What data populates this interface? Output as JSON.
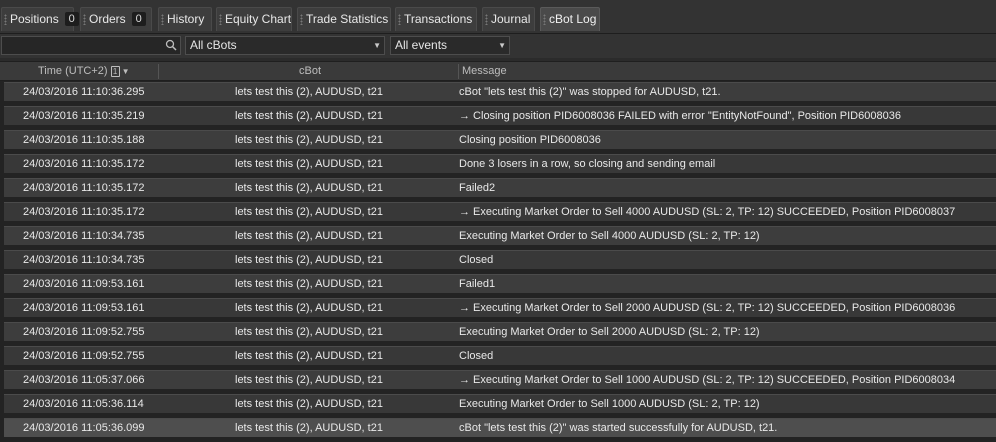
{
  "tabs": [
    {
      "label": "Positions",
      "count": "0"
    },
    {
      "label": "Orders",
      "count": "0"
    },
    {
      "label": "History"
    },
    {
      "label": "Equity Chart"
    },
    {
      "label": "Trade Statistics"
    },
    {
      "label": "Transactions"
    },
    {
      "label": "Journal"
    },
    {
      "label": "cBot Log"
    }
  ],
  "filters": {
    "search_value": "",
    "bot_filter": "All cBots",
    "event_filter": "All events"
  },
  "columns": {
    "time": "Time (UTC+2)",
    "sort_index": "1",
    "cbot": "cBot",
    "message": "Message"
  },
  "rows": [
    {
      "time": "24/03/2016 11:10:36.295",
      "cbot": "lets test this (2), AUDUSD, t21",
      "message": "cBot \"lets test this (2)\" was stopped for AUDUSD, t21."
    },
    {
      "time": "24/03/2016 11:10:35.219",
      "cbot": "lets test this (2), AUDUSD, t21",
      "message": "→ Closing position PID6008036 FAILED with error \"EntityNotFound\", Position PID6008036"
    },
    {
      "time": "24/03/2016 11:10:35.188",
      "cbot": "lets test this (2), AUDUSD, t21",
      "message": "Closing position PID6008036"
    },
    {
      "time": "24/03/2016 11:10:35.172",
      "cbot": "lets test this (2), AUDUSD, t21",
      "message": "Done 3 losers in a row, so closing and sending email"
    },
    {
      "time": "24/03/2016 11:10:35.172",
      "cbot": "lets test this (2), AUDUSD, t21",
      "message": "Failed2"
    },
    {
      "time": "24/03/2016 11:10:35.172",
      "cbot": "lets test this (2), AUDUSD, t21",
      "message": "→ Executing Market Order to Sell 4000 AUDUSD (SL: 2, TP: 12) SUCCEEDED, Position PID6008037"
    },
    {
      "time": "24/03/2016 11:10:34.735",
      "cbot": "lets test this (2), AUDUSD, t21",
      "message": "Executing Market Order to Sell 4000 AUDUSD (SL: 2, TP: 12)"
    },
    {
      "time": "24/03/2016 11:10:34.735",
      "cbot": "lets test this (2), AUDUSD, t21",
      "message": "Closed"
    },
    {
      "time": "24/03/2016 11:09:53.161",
      "cbot": "lets test this (2), AUDUSD, t21",
      "message": "Failed1"
    },
    {
      "time": "24/03/2016 11:09:53.161",
      "cbot": "lets test this (2), AUDUSD, t21",
      "message": "→ Executing Market Order to Sell 2000 AUDUSD (SL: 2, TP: 12) SUCCEEDED, Position PID6008036"
    },
    {
      "time": "24/03/2016 11:09:52.755",
      "cbot": "lets test this (2), AUDUSD, t21",
      "message": "Executing Market Order to Sell 2000 AUDUSD (SL: 2, TP: 12)"
    },
    {
      "time": "24/03/2016 11:09:52.755",
      "cbot": "lets test this (2), AUDUSD, t21",
      "message": "Closed"
    },
    {
      "time": "24/03/2016 11:05:37.066",
      "cbot": "lets test this (2), AUDUSD, t21",
      "message": "→ Executing Market Order to Sell 1000 AUDUSD (SL: 2, TP: 12) SUCCEEDED, Position PID6008034"
    },
    {
      "time": "24/03/2016 11:05:36.114",
      "cbot": "lets test this (2), AUDUSD, t21",
      "message": "Executing Market Order to Sell 1000 AUDUSD (SL: 2, TP: 12)"
    },
    {
      "time": "24/03/2016 11:05:36.099",
      "cbot": "lets test this (2), AUDUSD, t21",
      "message": "cBot \"lets test this (2)\" was started successfully for AUDUSD, t21."
    }
  ],
  "icons": {
    "search": "search-icon",
    "dropdown": "chevron-down-icon",
    "sort": "sort-desc-icon"
  }
}
